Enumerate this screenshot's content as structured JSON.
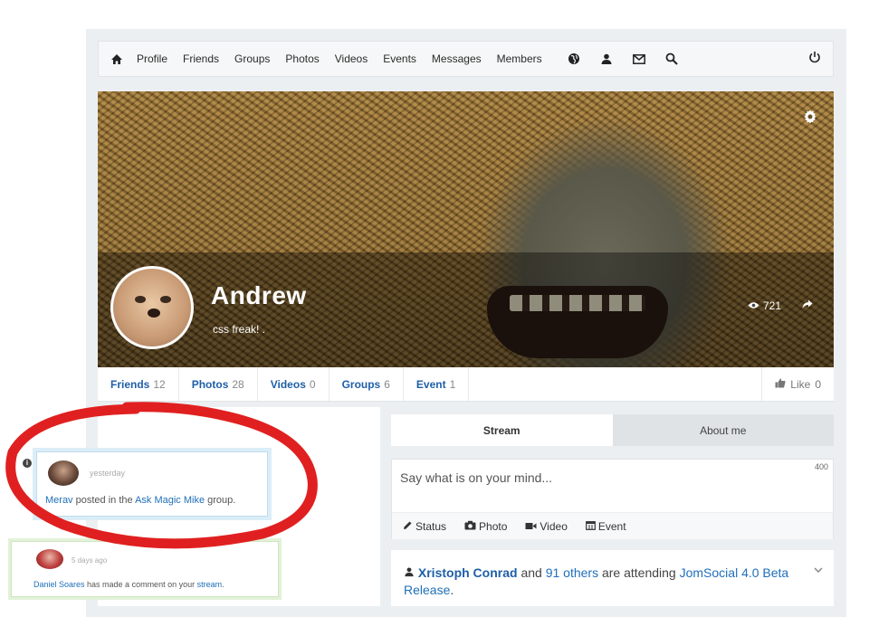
{
  "nav": {
    "links": [
      "Profile",
      "Friends",
      "Groups",
      "Photos",
      "Videos",
      "Events",
      "Messages",
      "Members"
    ],
    "icons": [
      "globe-icon",
      "user-icon",
      "mail-icon",
      "search-icon"
    ]
  },
  "profile": {
    "name": "Andrew",
    "tagline": "css freak! .",
    "views": "721"
  },
  "stats": {
    "friends_label": "Friends",
    "friends_count": "12",
    "photos_label": "Photos",
    "photos_count": "28",
    "videos_label": "Videos",
    "videos_count": "0",
    "groups_label": "Groups",
    "groups_count": "6",
    "event_label": "Event",
    "event_count": "1",
    "like_label": "Like",
    "like_count": "0"
  },
  "activity": [
    {
      "time": "yesterday",
      "user": "Merav",
      "text_a": " posted in the ",
      "link": "Ask Magic Mike",
      "text_b": " group."
    },
    {
      "time": "5 days ago",
      "user": "Daniel Soares",
      "text_a": " has made a comment on your ",
      "link": "stream",
      "text_b": "."
    }
  ],
  "tabs": {
    "stream": "Stream",
    "about": "About me"
  },
  "composer": {
    "placeholder": "Say what is on your mind...",
    "count": "400",
    "status": "Status",
    "photo": "Photo",
    "video": "Video",
    "event": "Event"
  },
  "post": {
    "user": "Xristoph Conrad",
    "and": " and ",
    "others": "91 others",
    "mid": " are attending ",
    "event": "JomSocial 4.0 Beta Release",
    "end": "."
  },
  "colors": {
    "link": "#1f5fa8",
    "highlight": "#e02020"
  }
}
